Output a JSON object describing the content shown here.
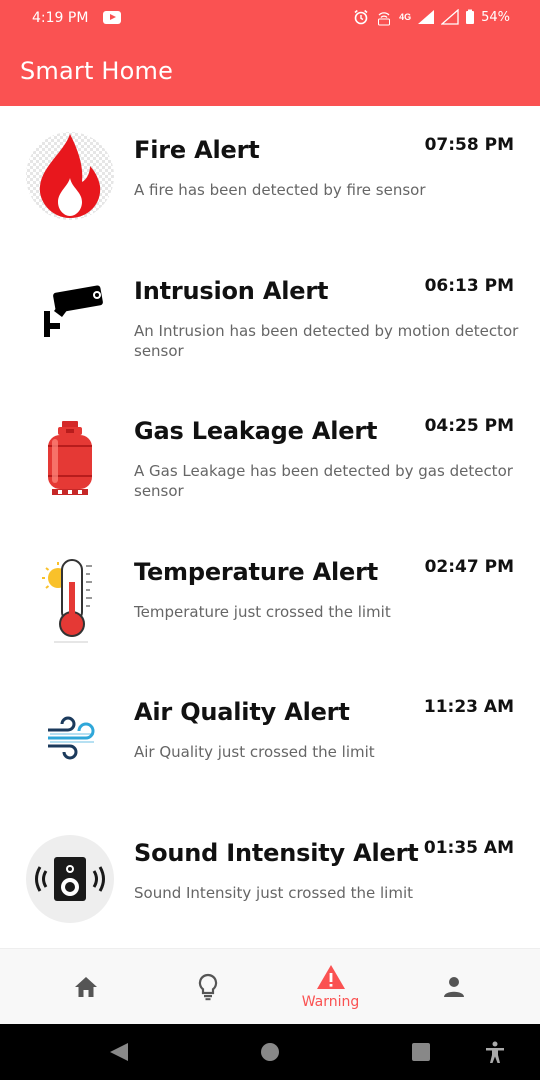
{
  "status_bar": {
    "time": "4:19 PM",
    "battery": "54%",
    "network": "4G"
  },
  "app_bar": {
    "title": "Smart Home"
  },
  "alerts": [
    {
      "title": "Fire Alert",
      "time": "07:58 PM",
      "description": "A fire has been detected by fire sensor",
      "icon": "fire-icon"
    },
    {
      "title": "Intrusion Alert",
      "time": "06:13 PM",
      "description": "An Intrusion has been detected by motion detector sensor",
      "icon": "security-camera-icon"
    },
    {
      "title": "Gas Leakage Alert",
      "time": "04:25 PM",
      "description": "A Gas Leakage has been detected by gas detector sensor",
      "icon": "gas-cylinder-icon"
    },
    {
      "title": "Temperature Alert",
      "time": "02:47 PM",
      "description": "Temperature just crossed the limit",
      "icon": "thermometer-icon"
    },
    {
      "title": "Air Quality Alert",
      "time": "11:23 AM",
      "description": "Air Quality just crossed the limit",
      "icon": "wind-icon"
    },
    {
      "title": "Sound Intensity Alert",
      "time": "01:35 AM",
      "description": "Sound Intensity just crossed the limit",
      "icon": "speaker-icon"
    }
  ],
  "bottom_nav": {
    "items": [
      {
        "icon": "home-icon",
        "label": ""
      },
      {
        "icon": "lightbulb-icon",
        "label": ""
      },
      {
        "icon": "warning-icon",
        "label": "Warning",
        "active": true
      },
      {
        "icon": "person-icon",
        "label": ""
      }
    ]
  },
  "colors": {
    "accent": "#fa5252",
    "text": "#111111",
    "muted": "#666666"
  }
}
